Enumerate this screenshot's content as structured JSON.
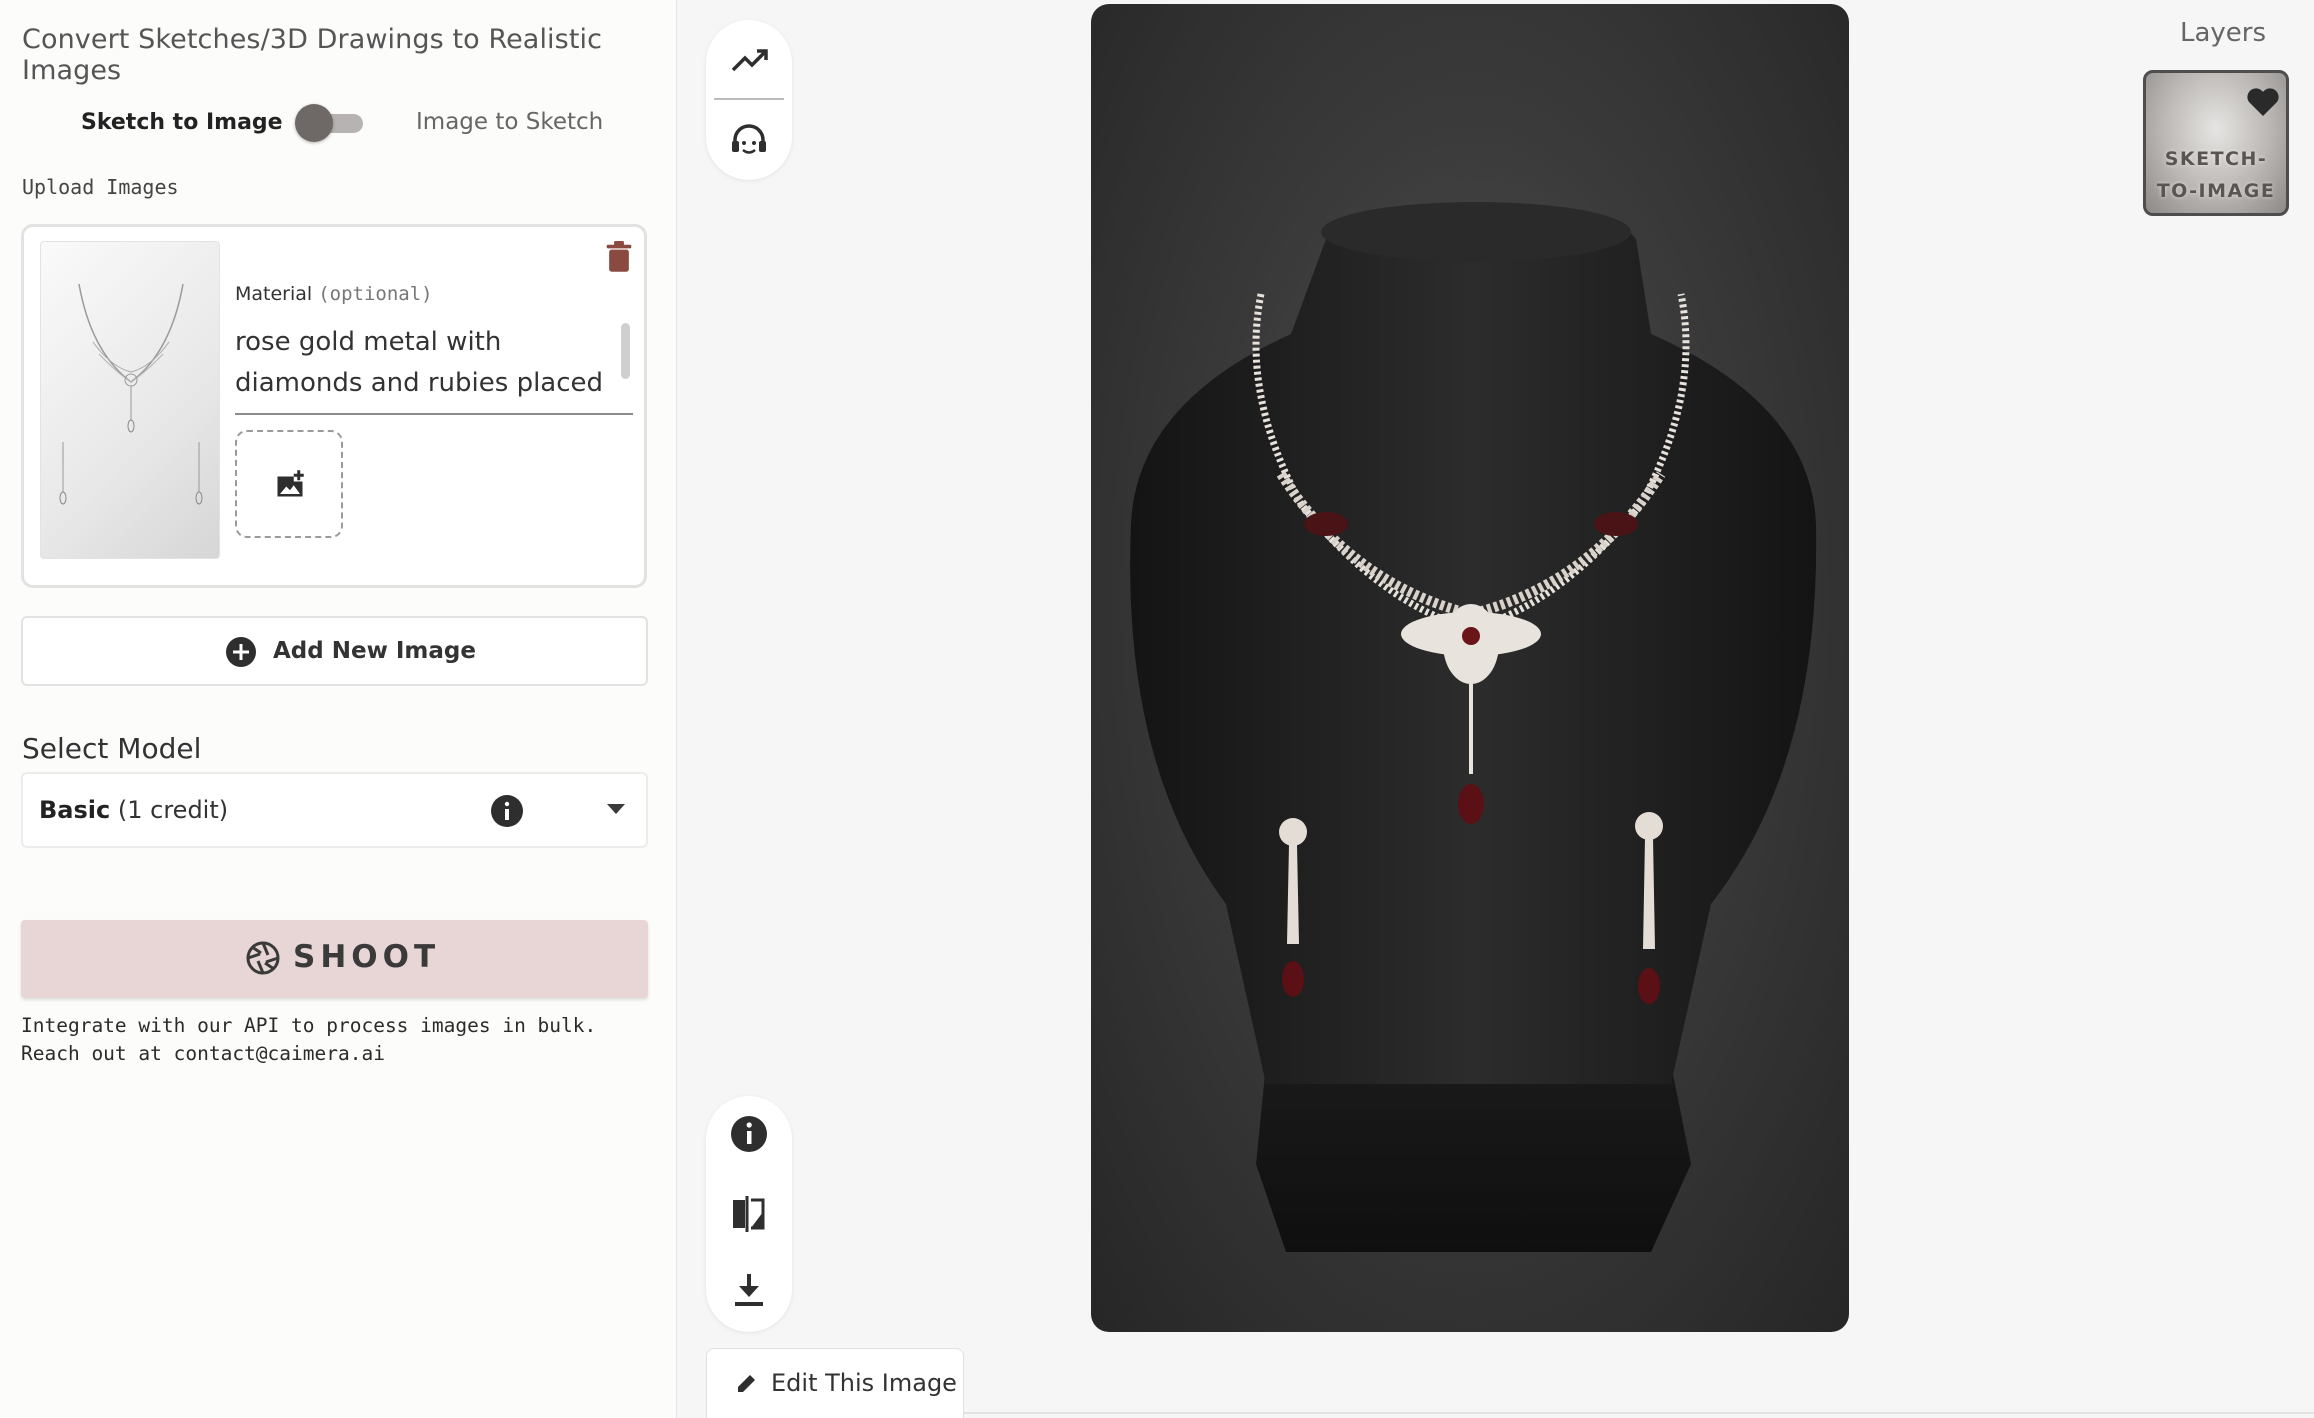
{
  "panel": {
    "title": "Convert Sketches/3D Drawings to Realistic Images",
    "mode_left": "Sketch to Image",
    "mode_right": "Image to Sketch",
    "upload_label": "Upload Images"
  },
  "upload_card": {
    "material_label": "Material",
    "material_optional": "(optional)",
    "material_text": "rose gold metal with diamonds and rubies placed on a black"
  },
  "add_new_image": "Add New Image",
  "model": {
    "section_label": "Select Model",
    "selected_name": "Basic",
    "selected_credit": "(1 credit)"
  },
  "shoot_label": "SHOOT",
  "api_note": "Integrate with our API to process images in bulk.\nReach out at contact@caimera.ai",
  "edit_image_label": "Edit This Image",
  "layers": {
    "title": "Layers",
    "item_label": "SKETCH-\nTO-IMAGE"
  },
  "colors": {
    "accent": "#e8d6d6",
    "trash": "#8a4a40",
    "panel_bg": "#fcfcfb",
    "canvas_bg": "#f6f6f7"
  },
  "icons": [
    "trending-up-icon",
    "support-headset-icon",
    "info-icon",
    "compare-icon",
    "download-icon",
    "trash-icon",
    "add-photo-icon",
    "add-circle-icon",
    "shutter-icon",
    "pencil-icon",
    "heart-icon",
    "chevron-down-icon"
  ]
}
